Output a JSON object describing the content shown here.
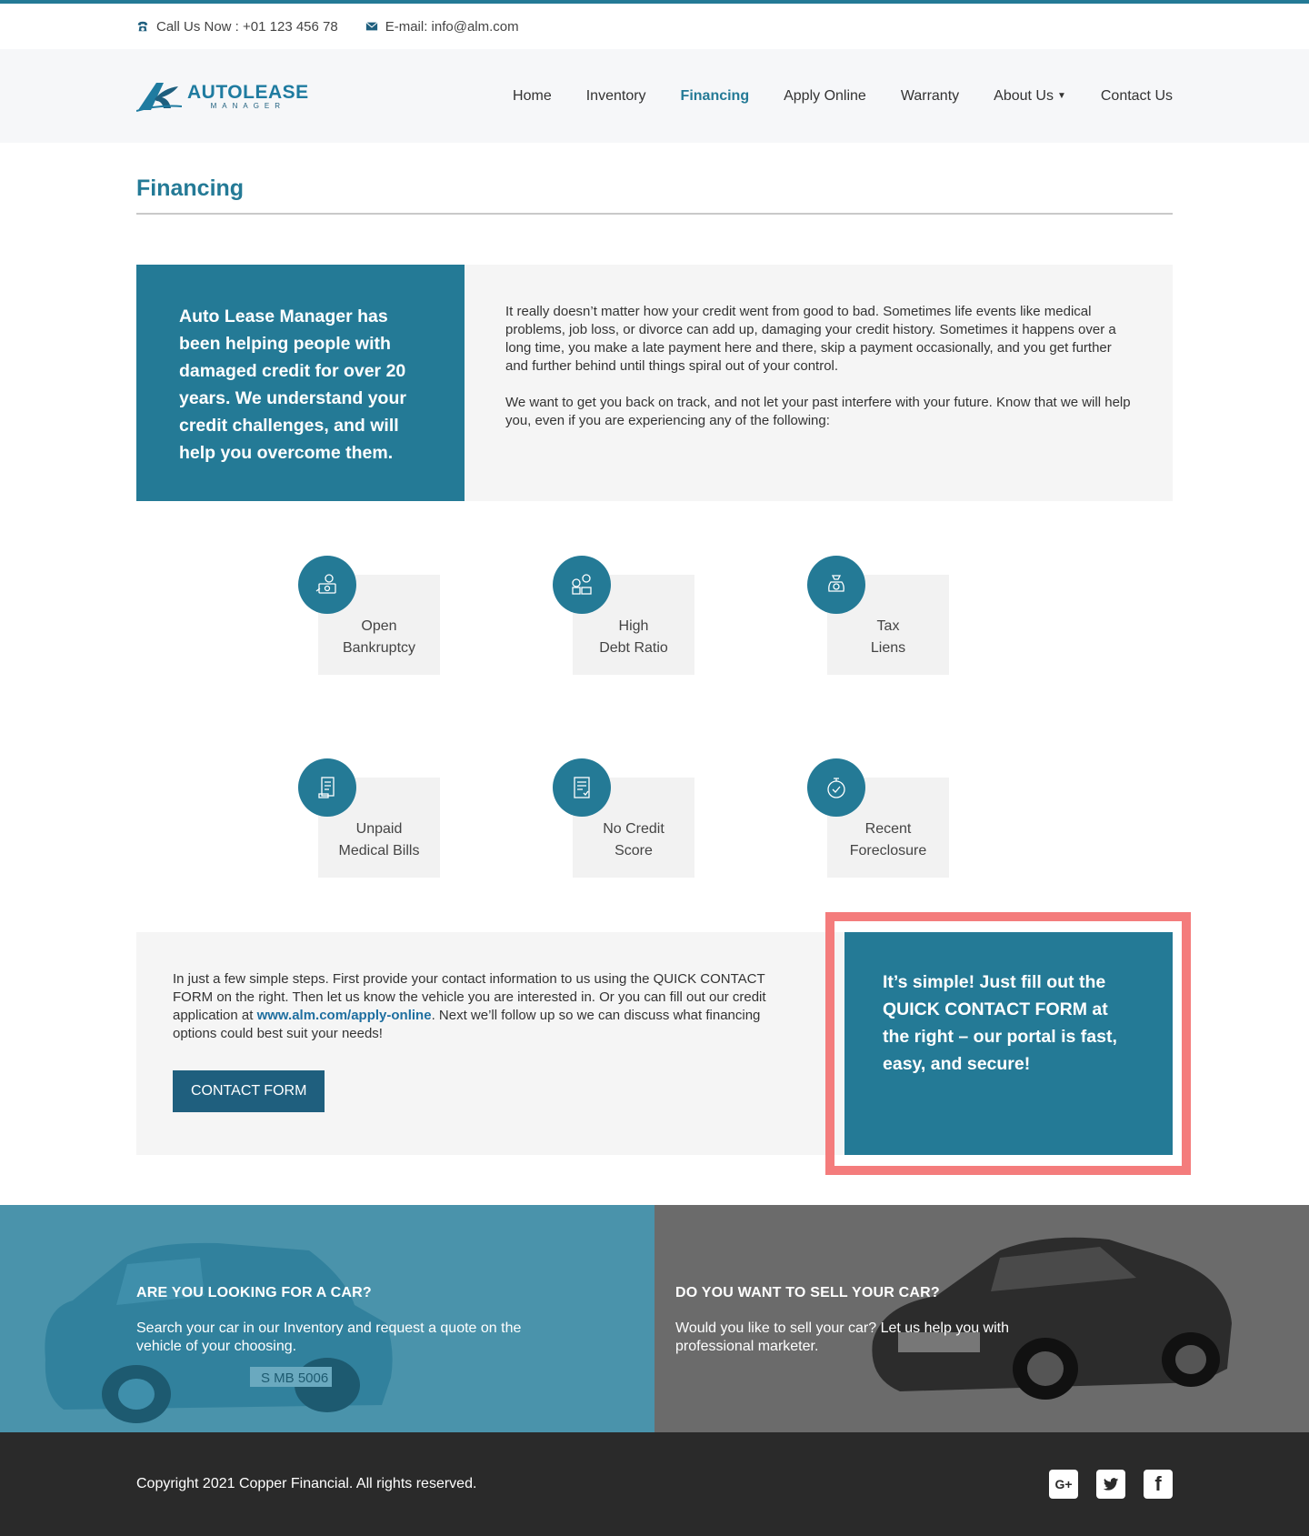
{
  "topbar": {
    "phone_label": "Call Us Now : +01 123 456 78",
    "email_label": "E-mail: info@alm.com",
    "phone_icon": "phone-icon",
    "email_icon": "envelope-icon"
  },
  "brand": {
    "title": "AUTOLEASE",
    "subtitle": "MANAGER",
    "accent_color": "#247a96"
  },
  "nav": {
    "items": [
      {
        "label": "Home",
        "active": false
      },
      {
        "label": "Inventory",
        "active": false
      },
      {
        "label": "Financing",
        "active": true
      },
      {
        "label": "Apply Online",
        "active": false
      },
      {
        "label": "Warranty",
        "active": false
      },
      {
        "label": "About Us",
        "active": false,
        "dropdown": true
      },
      {
        "label": "Contact Us",
        "active": false
      }
    ]
  },
  "page": {
    "title": "Financing"
  },
  "intro": {
    "headline": "Auto Lease Manager has been helping people with damaged credit for over 20 years. We understand your credit challenges, and will help you overcome them.",
    "paragraph1": "It really doesn’t matter how your credit went from good to bad. Sometimes life events like medical problems, job loss, or divorce can add up, damaging your credit history. Sometimes it happens over a long time, you make a late payment here and there, skip a payment occasionally, and you get further and further behind until things spiral out of your control.",
    "paragraph2": "We want to get you back on track, and not let your past interfere with your future. Know that we will help you, even if you are experiencing any of the following:"
  },
  "features": [
    {
      "line1": "Open",
      "line2": "Bankruptcy",
      "icon": "money-hand-icon"
    },
    {
      "line1": "High",
      "line2": "Debt Ratio",
      "icon": "coins-icon"
    },
    {
      "line1": "Tax",
      "line2": "Liens",
      "icon": "money-bag-icon"
    },
    {
      "line1": "Unpaid",
      "line2": "Medical Bills",
      "icon": "bill-icon"
    },
    {
      "line1": "No Credit",
      "line2": "Score",
      "icon": "document-icon"
    },
    {
      "line1": "Recent",
      "line2": "Foreclosure",
      "icon": "stopwatch-icon"
    }
  ],
  "steps": {
    "text_before_link": "In just a few simple steps. First provide your contact information to us using the QUICK CONTACT FORM on the right. Then let us know the vehicle you are interested in. Or you can fill out our credit application at ",
    "link_text": "www.alm.com/apply-online",
    "text_after_link": ". Next we’ll follow up so we can discuss what financing options could best suit your needs!",
    "button_label": "CONTACT FORM",
    "callout": "It’s simple! Just fill out the QUICK CONTACT FORM at the right – our portal is fast, easy, and secure!",
    "highlight_color": "#f47c7c"
  },
  "promo": {
    "left": {
      "title": "ARE YOU LOOKING FOR A CAR?",
      "desc": "Search your car in our Inventory and request a quote on the vehicle of your choosing.",
      "plate": "S MB 5006"
    },
    "right": {
      "title": "DO YOU WANT TO SELL YOUR CAR?",
      "desc": "Would you like to sell your car? Let us help you with professional marketer."
    }
  },
  "footer": {
    "copyright": "Copyright 2021 Copper Financial. All rights reserved.",
    "socials": [
      {
        "name": "google-plus-icon",
        "glyph": "G+"
      },
      {
        "name": "twitter-icon",
        "glyph": ""
      },
      {
        "name": "facebook-icon",
        "glyph": "f"
      }
    ]
  }
}
